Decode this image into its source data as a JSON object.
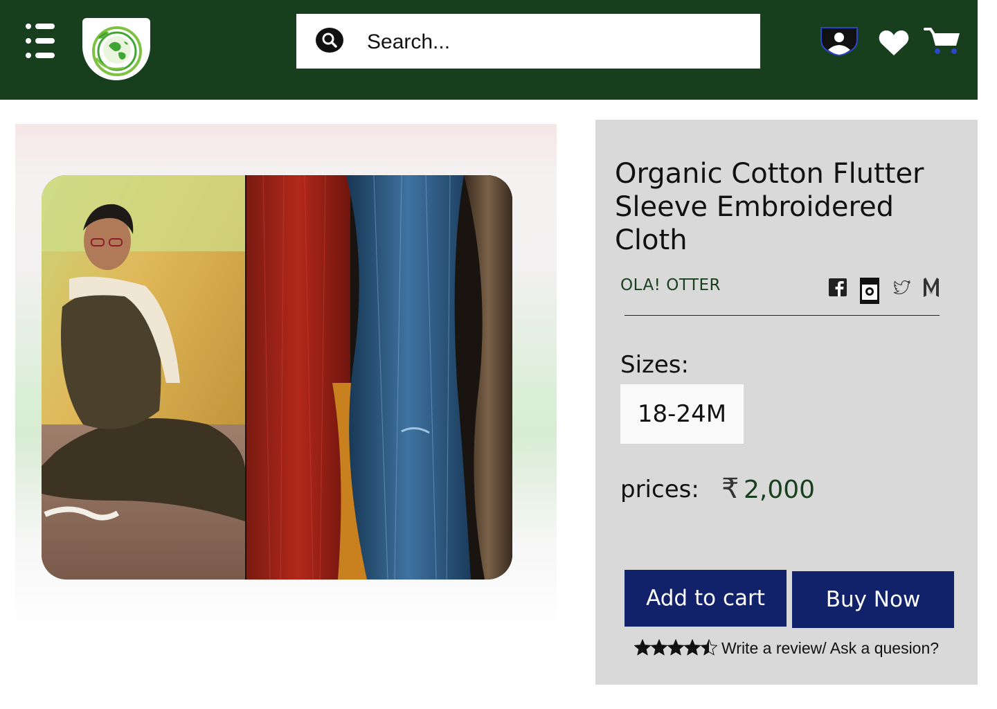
{
  "header": {
    "search_placeholder": "Search...",
    "icons": [
      "menu-icon",
      "logo",
      "search-icon",
      "account-icon",
      "heart-icon",
      "cart-icon"
    ],
    "background_color": "#173f1e"
  },
  "product": {
    "title": "Organic Cotton Flutter Sleeve Embroidered Cloth",
    "brand": "OLA! OTTER",
    "social_icons": [
      "facebook-icon",
      "instagram-icon",
      "twitter-icon",
      "medium-icon"
    ],
    "sizes_label": "Sizes:",
    "sizes": [
      "18-24M"
    ],
    "selected_size": "18-24M",
    "prices_label": "prices:",
    "currency_symbol": "₹",
    "price": "2,000",
    "add_to_cart_label": "Add to cart",
    "buy_now_label": "Buy Now",
    "rating": 4.5,
    "rating_max": 5,
    "review_link": "Write a review/ Ask a quesion?"
  },
  "colors": {
    "brand_green": "#173f1e",
    "button_navy": "#12226a",
    "panel_gray": "#d9d9d9"
  }
}
